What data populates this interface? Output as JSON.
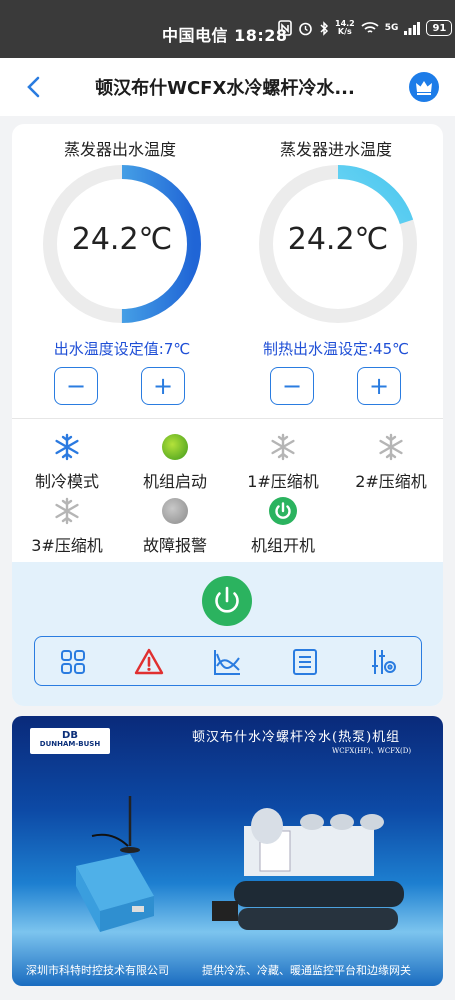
{
  "status_bar": {
    "carrier_time": "中国电信 18:28",
    "net_speed_value": "14.2",
    "net_speed_unit": "K/s",
    "signal": "5G",
    "battery": "91"
  },
  "header": {
    "title": "顿汉布什WCFX水冷螺杆冷水...",
    "back_icon": "back-chevron-icon",
    "crown_icon": "crown-icon"
  },
  "gauges": [
    {
      "label": "蒸发器出水温度",
      "value": "24.2℃",
      "fill_fraction": 0.5
    },
    {
      "label": "蒸发器进水温度",
      "value": "24.2℃",
      "fill_fraction": 0.2
    }
  ],
  "setpoints": {
    "left": "出水温度设定值:7℃",
    "right": "制热出水温设定:45℃",
    "minus": "−",
    "plus": "+"
  },
  "status_items": [
    {
      "label": "制冷模式",
      "icon": "snowflake-icon",
      "color": "#2b7ae0"
    },
    {
      "label": "机组启动",
      "icon": "green-dot-icon",
      "color": "#4aaa22"
    },
    {
      "label": "1#压缩机",
      "icon": "snowflake-icon",
      "color": "#b5b5b5"
    },
    {
      "label": "2#压缩机",
      "icon": "snowflake-icon",
      "color": "#b5b5b5"
    },
    {
      "label": "3#压缩机",
      "icon": "snowflake-icon",
      "color": "#b5b5b5"
    },
    {
      "label": "故障报警",
      "icon": "gray-dot-icon",
      "color": "#9a9a9a"
    },
    {
      "label": "机组开机",
      "icon": "power-icon",
      "color": "#2bb35f"
    }
  ],
  "toolbar": {
    "items": [
      "grid-icon",
      "alarm-warning-icon",
      "trend-chart-icon",
      "list-icon",
      "settings-sliders-icon"
    ]
  },
  "banner": {
    "logo_line1": "DB",
    "logo_line2": "DUNHAM-BUSH",
    "title": "顿汉布什水冷螺杆冷水(热泵)机组",
    "subtitle": "WCFX(HP)、WCFX(D)",
    "footer_left": "深圳市科特时控技术有限公司",
    "footer_right": "提供冷冻、冷藏、暖通监控平台和边缘网关"
  },
  "colors": {
    "accent": "#2a7ce0",
    "setpoint_text": "#1f4fd6",
    "power_green": "#2bb35f",
    "alarm_red": "#e03030"
  }
}
